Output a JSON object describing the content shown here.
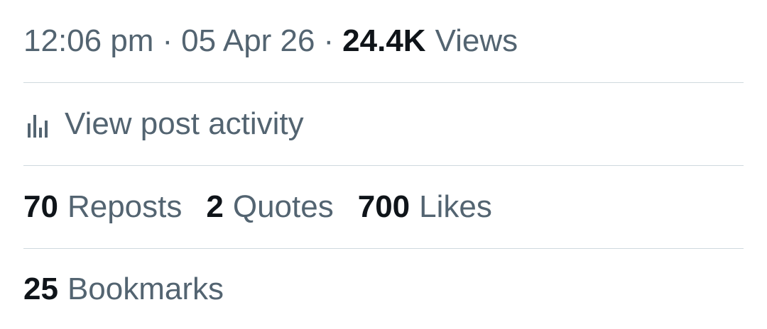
{
  "post_meta": {
    "time": "12:06 pm",
    "separator": "·",
    "date": "05 Apr 26",
    "views_count": "24.4K",
    "views_label": "Views"
  },
  "activity": {
    "label": "View post activity",
    "icon": "bar-chart-icon"
  },
  "stats": {
    "reposts_count": "70",
    "reposts_label": "Reposts",
    "quotes_count": "2",
    "quotes_label": "Quotes",
    "likes_count": "700",
    "likes_label": "Likes",
    "bookmarks_count": "25",
    "bookmarks_label": "Bookmarks"
  },
  "colors": {
    "primary_text": "#0f1419",
    "secondary_text": "#536471",
    "divider": "#cfd9de",
    "background": "#ffffff"
  }
}
